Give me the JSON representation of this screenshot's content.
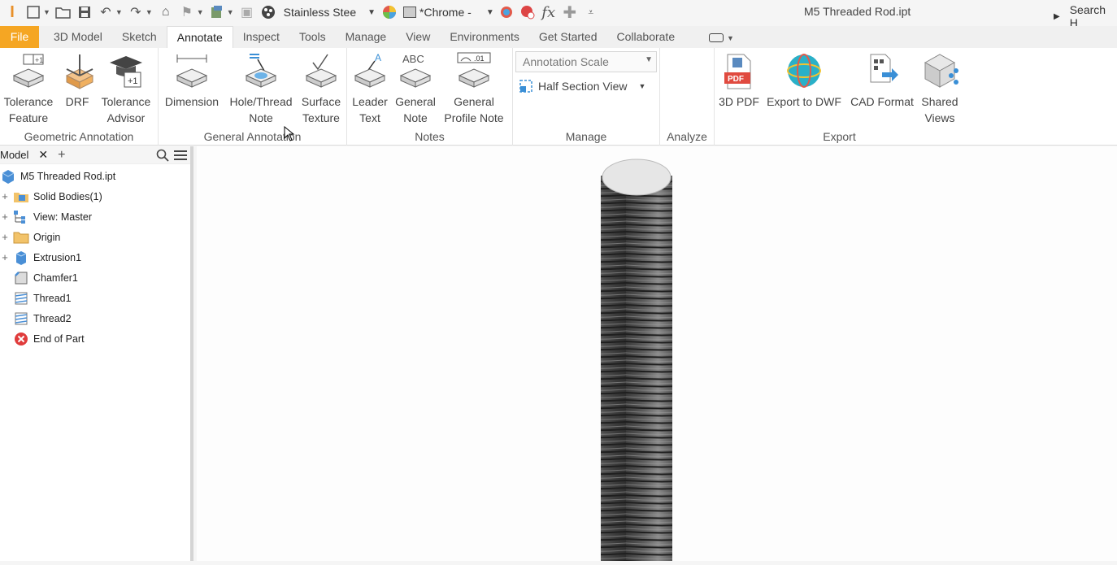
{
  "qat": {
    "material": "Stainless Stee",
    "appearance": "*Chrome -",
    "fx_label": "fx",
    "document_title": "M5 Threaded Rod.ipt",
    "search_label": "Search H"
  },
  "tabs": [
    "File",
    "3D Model",
    "Sketch",
    "Annotate",
    "Inspect",
    "Tools",
    "Manage",
    "View",
    "Environments",
    "Get Started",
    "Collaborate"
  ],
  "active_tab": "Annotate",
  "ribbon": {
    "panels": {
      "geometric": "Geometric Annotation",
      "general": "General Annotation",
      "notes": "Notes",
      "manage": "Manage",
      "analyze": "Analyze",
      "export": "Export"
    },
    "buttons": {
      "tolerance_feature": [
        "Tolerance",
        "Feature"
      ],
      "drf": "DRF",
      "tolerance_advisor": [
        "Tolerance",
        "Advisor"
      ],
      "dimension": "Dimension",
      "hole_thread_note": [
        "Hole/Thread",
        "Note"
      ],
      "surface_texture": [
        "Surface",
        "Texture"
      ],
      "leader_text": [
        "Leader",
        "Text"
      ],
      "general_note": [
        "General",
        "Note"
      ],
      "general_profile_note": [
        "General",
        "Profile Note"
      ],
      "pdf_3d": "3D PDF",
      "export_dwf": "Export to DWF",
      "cad_format": "CAD Format",
      "shared_views": [
        "Shared",
        "Views"
      ]
    },
    "annotation_scale": "Annotation Scale",
    "half_section_view": "Half Section View"
  },
  "browser": {
    "tab": "Model",
    "tree": [
      {
        "label": "M5 Threaded Rod.ipt",
        "expand": false,
        "icon": "part-icon"
      },
      {
        "label": "Solid Bodies(1)",
        "expand": true,
        "icon": "solid-bodies-folder-icon"
      },
      {
        "label": "View: Master",
        "expand": true,
        "icon": "view-rep-icon"
      },
      {
        "label": "Origin",
        "expand": true,
        "icon": "origin-folder-icon"
      },
      {
        "label": "Extrusion1",
        "expand": true,
        "icon": "extrusion-icon"
      },
      {
        "label": "Chamfer1",
        "expand": false,
        "icon": "chamfer-icon"
      },
      {
        "label": "Thread1",
        "expand": false,
        "icon": "thread-icon"
      },
      {
        "label": "Thread2",
        "expand": false,
        "icon": "thread-icon"
      },
      {
        "label": "End of Part",
        "expand": false,
        "icon": "end-of-part-icon"
      }
    ]
  },
  "colors": {
    "file_tab": "#f5a623",
    "accent_blue": "#3a8fd6",
    "end_of_part": "#e03c3c",
    "pdf_red": "#e04a3f"
  }
}
